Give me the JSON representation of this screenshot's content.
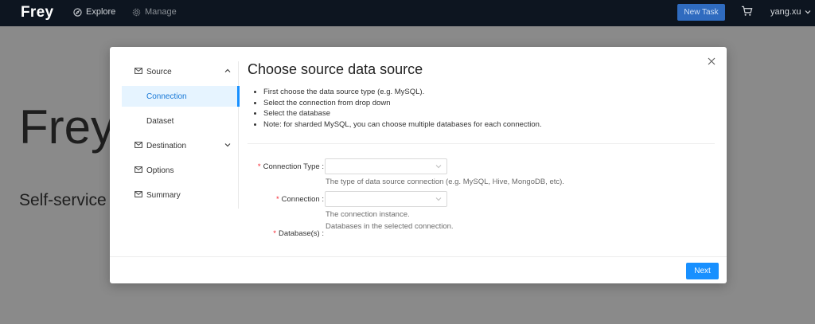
{
  "topbar": {
    "brand": "Frey",
    "nav": [
      {
        "label": "Explore",
        "icon": "compass-icon"
      },
      {
        "label": "Manage",
        "icon": "gear-icon"
      }
    ],
    "new_task_label": "New Task",
    "user_name": "yang.xu"
  },
  "background": {
    "title": "Frey",
    "subtitle": "Self-service"
  },
  "modal": {
    "sidebar": [
      {
        "label": "Source",
        "icon": "mail-icon",
        "expanded": true
      },
      {
        "label": "Connection",
        "active": true
      },
      {
        "label": "Dataset"
      },
      {
        "label": "Destination",
        "icon": "mail-icon",
        "expanded": false
      },
      {
        "label": "Options",
        "icon": "mail-icon"
      },
      {
        "label": "Summary",
        "icon": "mail-icon"
      }
    ],
    "title": "Choose source data source",
    "bullets": [
      "First choose the data source type (e.g. MySQL).",
      "Select the connection from drop down",
      "Select the database",
      "Note: for sharded MySQL, you can choose multiple databases for each connection."
    ],
    "form": {
      "connection_type": {
        "label": "Connection Type",
        "hint": "The type of data source connection (e.g. MySQL, Hive, MongoDB, etc)."
      },
      "connection": {
        "label": "Connection",
        "hint": "The connection instance."
      },
      "databases": {
        "label": "Database(s)",
        "hint": "Databases in the selected connection."
      }
    },
    "next_label": "Next"
  },
  "colors": {
    "topbar_bg": "#0d1520",
    "primary": "#1890ff",
    "active_bg": "#e6f4ff",
    "required": "#f5222d",
    "overlay_bg": "#8a8a8a"
  }
}
